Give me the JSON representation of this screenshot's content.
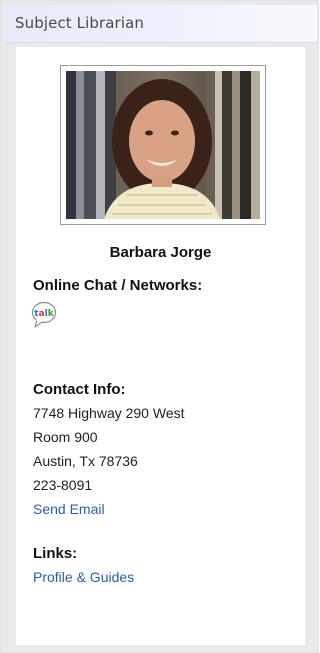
{
  "widget": {
    "title": "Subject Librarian"
  },
  "librarian": {
    "name": "Barbara Jorge",
    "online_heading": "Online Chat / Networks:",
    "chat_icon_text": "talk",
    "contact_heading": "Contact Info:",
    "address_line1": "7748 Highway 290 West",
    "address_line2": "Room 900",
    "address_line3": "Austin, Tx 78736",
    "phone": "223-8091",
    "email_link": "Send Email",
    "links_heading": "Links:",
    "profile_link": "Profile & Guides"
  },
  "colors": {
    "link": "#2a5db0",
    "header_bg": "#e6ebf7",
    "widget_bg": "#e9e9ec"
  }
}
